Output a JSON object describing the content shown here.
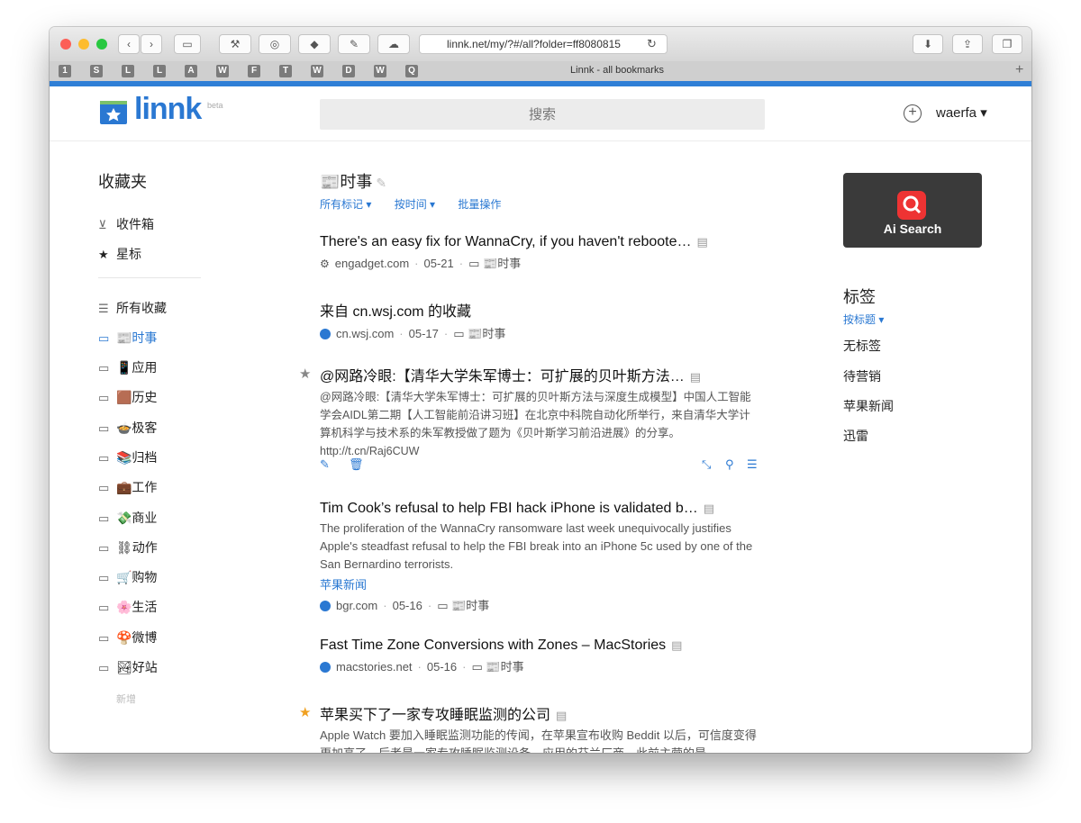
{
  "browser": {
    "url": "linnk.net/my/?#/all?folder=ff8080815",
    "tab_title": "Linnk - all bookmarks",
    "favicons": [
      "1",
      "S",
      "L",
      "L",
      "A",
      "W",
      "F",
      "T",
      "W",
      "D",
      "W",
      "Q"
    ],
    "tab_add": "+"
  },
  "header": {
    "logo": "linnk",
    "beta": "beta",
    "search_placeholder": "搜索",
    "add_icon": "+",
    "user": "waerfa ▾"
  },
  "sidebar": {
    "title": "收藏夹",
    "top_items": [
      {
        "icon": "inbox-icon",
        "label": "收件箱"
      },
      {
        "icon": "star-icon",
        "label": "星标"
      }
    ],
    "all_label": "所有收藏",
    "folders": [
      {
        "label": "📰时事",
        "active": true
      },
      {
        "label": "📱应用"
      },
      {
        "label": "🟫历史"
      },
      {
        "label": "🍲极客"
      },
      {
        "label": "📚归档"
      },
      {
        "label": "💼工作"
      },
      {
        "label": "💸商业"
      },
      {
        "label": "⛓动作"
      },
      {
        "label": "🛒购物"
      },
      {
        "label": "🌸生活"
      },
      {
        "label": "🍄微博"
      },
      {
        "label": "🏞好站"
      }
    ],
    "new_label": "新增"
  },
  "main": {
    "title": "📰时事",
    "filters": [
      "所有标记 ▾",
      "按时间 ▾",
      "批量操作"
    ],
    "items": [
      {
        "title": "There's an easy fix for WannaCry, if you haven't reboote…",
        "source": "engadget.com",
        "date": "05-21",
        "folder": "📰时事"
      },
      {
        "title": "来自 cn.wsj.com 的收藏",
        "source": "cn.wsj.com",
        "date": "05-17",
        "folder": "📰时事"
      },
      {
        "title": "@网路冷眼:【清华大学朱军博士：可扩展的贝叶斯方法…",
        "desc": "@网路冷眼:【清华大学朱军博士：可扩展的贝叶斯方法与深度生成模型】中国人工智能学会AIDL第二期【人工智能前沿讲习班】在北京中科院自动化所举行，来自清华大学计算机科学与技术系的朱军教授做了题为《贝叶斯学习前沿进展》的分享。http://t.cn/Raj6CUW",
        "starred": true
      },
      {
        "title": "Tim Cook’s refusal to help FBI hack iPhone is validated b…",
        "desc": "The proliferation of the WannaCry ransomware last week unequivocally justifies Apple's steadfast refusal to help the FBI break into an iPhone 5c used by one of the San Bernardino terrorists.",
        "tag": "苹果新闻",
        "source": "bgr.com",
        "date": "05-16",
        "folder": "📰时事"
      },
      {
        "title": "Fast Time Zone Conversions with Zones – MacStories",
        "source": "macstories.net",
        "date": "05-16",
        "folder": "📰时事"
      },
      {
        "title": "苹果买下了一家专攻睡眠监测的公司",
        "desc": "Apple Watch 要加入睡眠监测功能的传闻，在苹果宣布收购 Beddit 以后，可信度变得更加高了。后者是一家专攻睡眠监测设备、应用的芬兰厂商，此前主营的是",
        "starred_gold": true
      }
    ]
  },
  "right": {
    "promo_text": "Ai Search",
    "tags_title": "标签",
    "tags_sort": "按标题 ▾",
    "tags": [
      "无标签",
      "待营销",
      "苹果新闻",
      "迅雷"
    ]
  },
  "colors": {
    "accent": "#2a78d2",
    "star_gold": "#f0a020"
  }
}
